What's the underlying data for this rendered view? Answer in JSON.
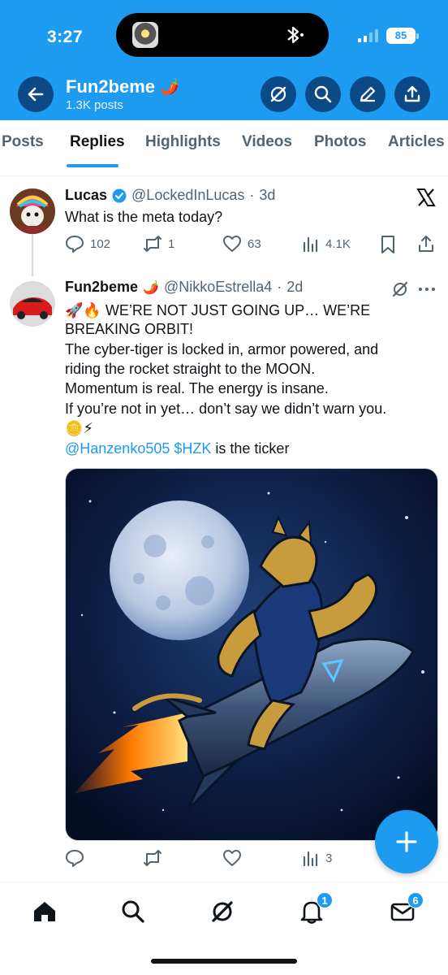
{
  "status_bar": {
    "time": "3:27",
    "battery": "85",
    "icons": [
      "island-app-icon",
      "bluetooth-icon",
      "signal-icon",
      "battery-icon"
    ]
  },
  "header": {
    "title": "Fun2beme",
    "title_emoji": "🌶️",
    "subtitle": "1.3K posts",
    "buttons": [
      "back-icon",
      "grok-icon",
      "search-icon",
      "edit-icon",
      "share-icon"
    ]
  },
  "tabs": {
    "items": [
      "Posts",
      "Replies",
      "Highlights",
      "Videos",
      "Photos",
      "Articles"
    ],
    "active": "Replies"
  },
  "parent_post": {
    "name": "Lucas",
    "verified": true,
    "handle": "@LockedInLucas",
    "sep": "·",
    "time": "3d",
    "text": "What is the meta today?",
    "replies": "102",
    "reposts": "1",
    "likes": "63",
    "views": "4.1K",
    "source_icon": "x-logo-icon"
  },
  "reply_post": {
    "name": "Fun2beme",
    "name_emoji": "🌶️",
    "handle": "@NikkoEstrella4",
    "sep": "·",
    "time": "2d",
    "lines": [
      "🚀🔥 WE’RE NOT JUST GOING UP… WE’RE",
      "BREAKING ORBIT!",
      "The cyber-tiger is locked in, armor powered, and",
      "riding the rocket straight to the MOON.",
      "Momentum is real. The energy is insane.",
      "If you’re not in yet… don’t say we didn’t warn you.",
      "🪙⚡"
    ],
    "mention": "@Hanzenko505",
    "cashtag": "$HZK",
    "tail": "is the ticker",
    "views": "3",
    "media_description_icon": "tiger-rocket-moon-image"
  },
  "bottom_nav": {
    "items": [
      "home-icon",
      "search-icon",
      "grok-icon",
      "notifications-icon",
      "messages-icon"
    ],
    "notifications_badge": "1",
    "messages_badge": "6"
  },
  "colors": {
    "brand_blue": "#1d9bf0",
    "header_button": "#0b4a86",
    "text": "#0f1419",
    "muted": "#536471"
  }
}
